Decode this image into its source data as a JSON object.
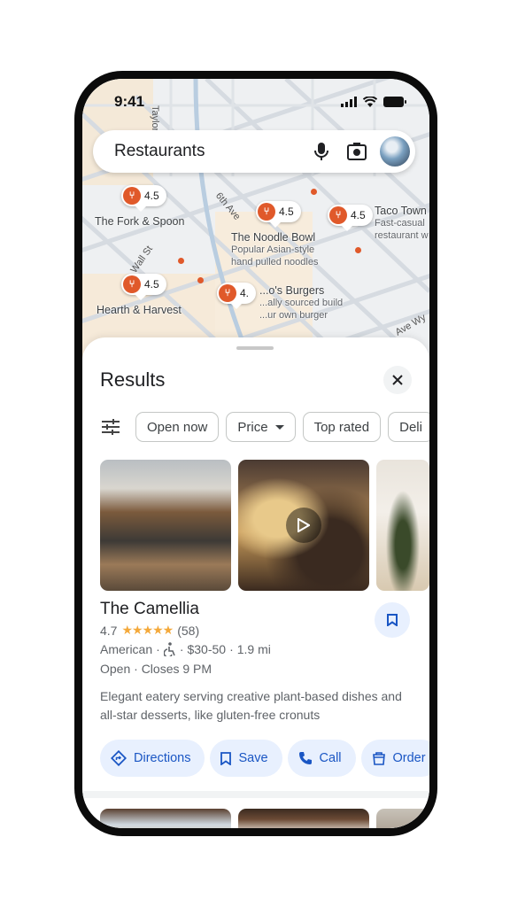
{
  "status_bar": {
    "time": "9:41"
  },
  "search": {
    "query": "Restaurants",
    "mic_icon": "mic-icon",
    "camera_icon": "camera-lens-icon"
  },
  "map": {
    "street_labels": [
      "Taylor",
      "6th Ave",
      "Wall St",
      "Ave Wy"
    ],
    "pins": [
      {
        "rating": "4.5",
        "name": "The Fork & Spoon",
        "desc": ""
      },
      {
        "rating": "4.5",
        "name": "The Noodle Bowl",
        "desc": "Popular Asian-style hand pulled noodles"
      },
      {
        "rating": "4.5",
        "name": "Taco Town",
        "desc": "Fast-casual restaurant w"
      },
      {
        "rating": "4.5",
        "name": "Hearth & Harvest",
        "desc": ""
      },
      {
        "rating": "4.",
        "name": "...o's Burgers",
        "desc": "...ally sourced build ...ur own burger"
      }
    ]
  },
  "sheet": {
    "title": "Results",
    "filters": [
      {
        "label": "Open now",
        "has_dropdown": false
      },
      {
        "label": "Price",
        "has_dropdown": true
      },
      {
        "label": "Top rated",
        "has_dropdown": false
      },
      {
        "label": "Deli",
        "has_dropdown": false
      }
    ],
    "result": {
      "name": "The Camellia",
      "rating": "4.7",
      "stars": "★★★★★",
      "star_fraction": 0.94,
      "review_count": "(58)",
      "cuisine": "American",
      "accessibility_icon": "wheelchair-icon",
      "price": "$30-50",
      "distance": "1.9 mi",
      "sep": "·",
      "hours": "Open · Closes 9 PM",
      "description": "Elegant eatery serving creative plant-based dishes and all-star desserts, like gluten-free cronuts",
      "actions": [
        {
          "label": "Directions",
          "icon": "directions-icon"
        },
        {
          "label": "Save",
          "icon": "bookmark-icon"
        },
        {
          "label": "Call",
          "icon": "phone-icon"
        },
        {
          "label": "Order",
          "icon": "order-bag-icon"
        }
      ]
    }
  },
  "colors": {
    "accent_blue": "#1a56c4",
    "chip_bg": "#e8f0fe",
    "pin_orange": "#e0592a",
    "star": "#f4a93b"
  }
}
